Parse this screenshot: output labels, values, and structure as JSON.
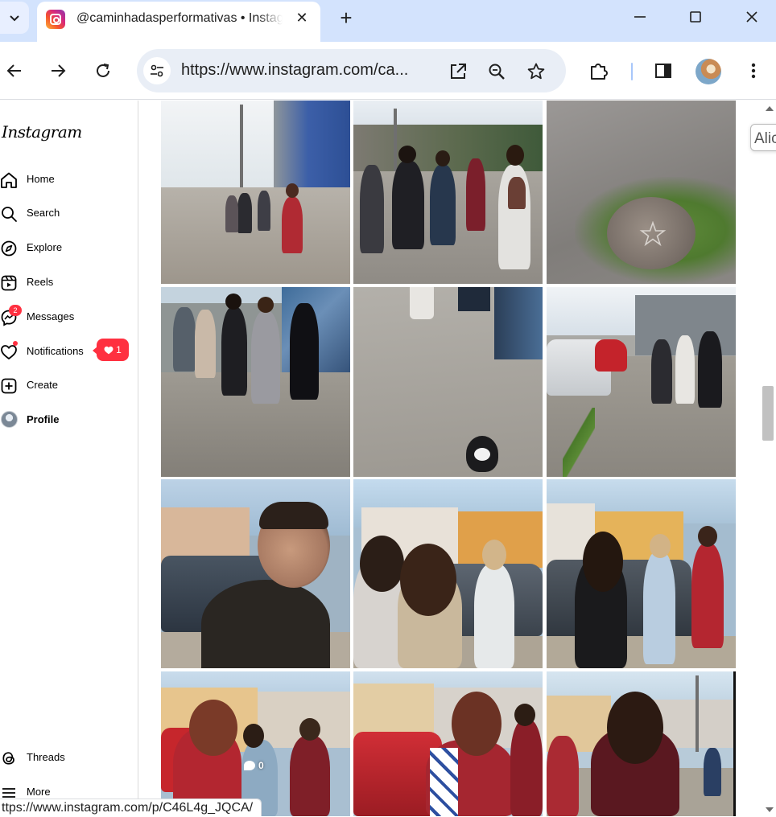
{
  "browser": {
    "tab_title": "@caminhadasperformativas • Instagram",
    "tab_close": "✕",
    "new_tab": "+",
    "url": "https://www.instagram.com/ca...",
    "accent": "#d3e3fd"
  },
  "sidebar": {
    "logo": "Instagram",
    "items": [
      {
        "label": "Home",
        "icon": "home-icon"
      },
      {
        "label": "Search",
        "icon": "search-icon"
      },
      {
        "label": "Explore",
        "icon": "compass-icon"
      },
      {
        "label": "Reels",
        "icon": "reels-icon"
      },
      {
        "label": "Messages",
        "icon": "messenger-icon",
        "badge": "2"
      },
      {
        "label": "Notifications",
        "icon": "heart-icon",
        "pill_count": "1"
      },
      {
        "label": "Create",
        "icon": "plus-square-icon"
      },
      {
        "label": "Profile",
        "icon": "avatar"
      },
      {
        "label": "Threads",
        "icon": "threads-icon"
      },
      {
        "label": "More",
        "icon": "menu-icon"
      }
    ],
    "badge_color": "#ff3040"
  },
  "grid": {
    "comment_count": "0"
  },
  "side_widget": {
    "text": "Alic"
  },
  "status_bar": {
    "text": "ttps://www.instagram.com/p/C46L4g_JQCA/"
  }
}
